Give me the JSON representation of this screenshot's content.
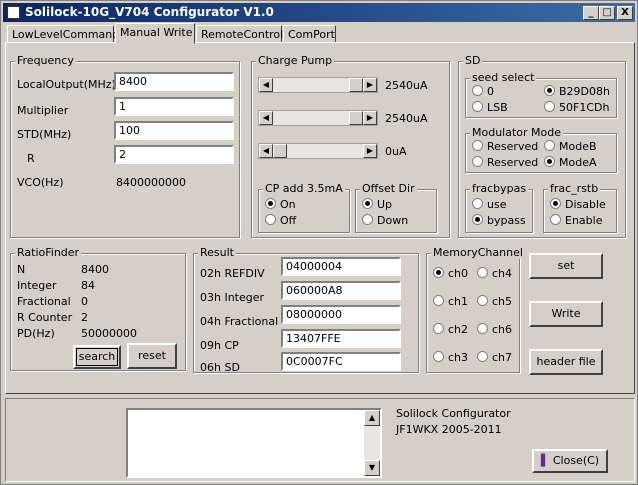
{
  "window": {
    "title": "Solilock-10G_V704 Configurator  V1.0",
    "min": "_",
    "max": "□",
    "close": "X"
  },
  "tabs": [
    "LowLevelCommand",
    "Manual Write",
    "RemoteControl",
    "ComPort"
  ],
  "frequency": {
    "title": "Frequency",
    "local_label": "LocalOutput(MHz)",
    "local_value": "8400",
    "mult_label": "Multiplier",
    "mult_value": "1",
    "std_label": "STD(MHz)",
    "std_value": "100",
    "r_label": "R",
    "r_value": "2",
    "vco_label": "VCO(Hz)",
    "vco_value": "8400000000"
  },
  "charge_pump": {
    "title": "Charge Pump",
    "sliders": [
      {
        "value": "2540uA",
        "level": 1.0
      },
      {
        "value": "2540uA",
        "level": 1.0
      },
      {
        "value": "0uA",
        "level": 0.0
      }
    ],
    "cp_add": {
      "title": "CP add 3.5mA",
      "on": "On",
      "off": "Off",
      "selected": "On"
    },
    "offset_dir": {
      "title": "Offset Dir",
      "up": "Up",
      "down": "Down",
      "selected": "Up"
    }
  },
  "sd": {
    "title": "SD",
    "seed": {
      "title": "seed select",
      "opt0": "0",
      "opt1": "B29D08h",
      "opt2": "LSB",
      "opt3": "50F1CDh",
      "selected": "B29D08h"
    },
    "modulator": {
      "title": "Modulator Mode",
      "opt0": "Reserved",
      "opt1": "ModeB",
      "opt2": "Reserved",
      "opt3": "ModeA",
      "selected": "ModeA"
    },
    "fracbypas": {
      "title": "fracbypas",
      "use": "use",
      "bypass": "bypass",
      "selected": "bypass"
    },
    "frac_rstb": {
      "title": "frac_rstb",
      "disable": "Disable",
      "enable": "Enable",
      "selected": "Disable"
    }
  },
  "ratio": {
    "title": "RatioFinder",
    "rows": [
      {
        "label": "N",
        "value": "8400"
      },
      {
        "label": "Integer",
        "value": "84"
      },
      {
        "label": "Fractional",
        "value": "0"
      },
      {
        "label": "R Counter",
        "value": "2"
      },
      {
        "label": "PD(Hz)",
        "value": "50000000"
      }
    ],
    "search": "search",
    "reset": "reset"
  },
  "result": {
    "title": "Result",
    "rows": [
      {
        "label": "02h REFDIV",
        "value": "04000004"
      },
      {
        "label": "03h Integer",
        "value": "060000A8"
      },
      {
        "label": "04h Fractional",
        "value": "08000000"
      },
      {
        "label": "09h CP",
        "value": "13407FFE"
      },
      {
        "label": "06h SD",
        "value": "0C0007FC"
      }
    ]
  },
  "memory": {
    "title": "MemoryChannel",
    "channels": [
      "ch0",
      "ch4",
      "ch1",
      "ch5",
      "ch2",
      "ch6",
      "ch3",
      "ch7"
    ],
    "selected": "ch0"
  },
  "actions": {
    "set": "set",
    "write": "Write",
    "header": "header file"
  },
  "footer": {
    "line1": "Solilock Configurator",
    "line2": "JF1WKX  2005-2011",
    "close": "Close(C)"
  }
}
